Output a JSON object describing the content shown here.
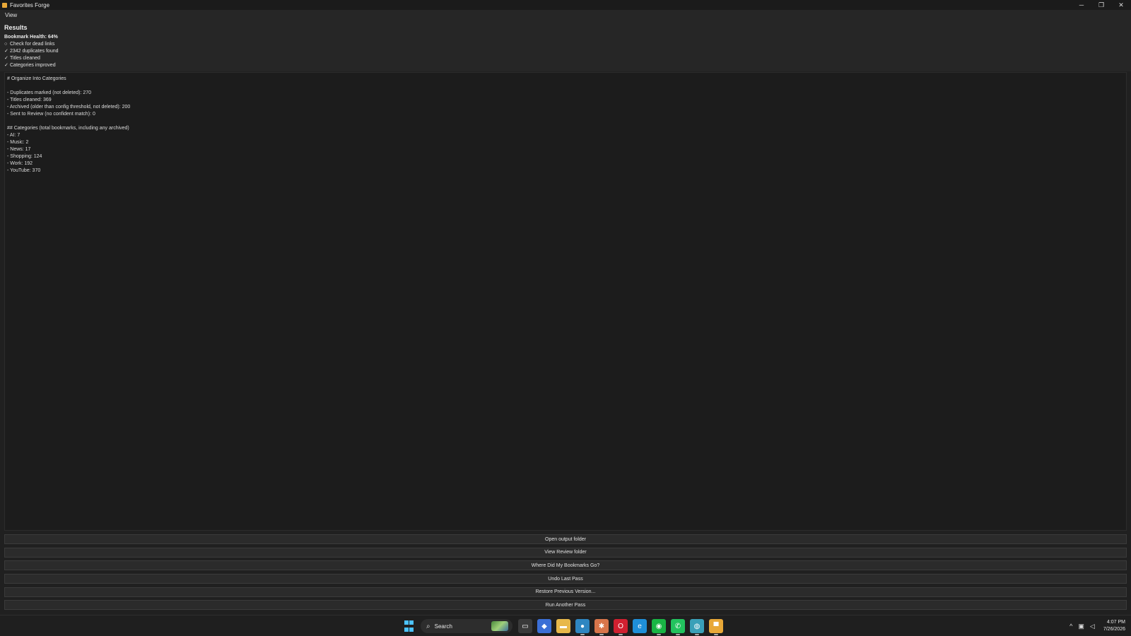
{
  "window": {
    "title": "Favorites Forge",
    "controls": {
      "minimize": "─",
      "restore": "❐",
      "close": "✕"
    }
  },
  "menu": {
    "items": [
      "View"
    ]
  },
  "summary": {
    "title": "Results",
    "health": "Bookmark Health: 64%",
    "checks": [
      {
        "mark": "○",
        "text": "Check for dead links"
      },
      {
        "mark": "✓",
        "text": "2342 duplicates found"
      },
      {
        "mark": "✓",
        "text": "Titles cleaned"
      },
      {
        "mark": "✓",
        "text": "Categories improved"
      }
    ]
  },
  "report": {
    "lines": [
      "# Organize Into Categories",
      "",
      "- Duplicates marked (not deleted): 270",
      "- Titles cleaned: 369",
      "- Archived (older than config threshold, not deleted): 200",
      "- Sent to Review (no confident match): 0",
      "",
      "## Categories (total bookmarks, including any archived)",
      "- AI: 7",
      "- Music: 2",
      "- News: 17",
      "- Shopping: 124",
      "- Work: 192",
      "- YouTube: 370"
    ]
  },
  "actions": [
    {
      "name": "open-output-folder-button",
      "label": "Open output folder"
    },
    {
      "name": "view-review-folder-button",
      "label": "View Review folder"
    },
    {
      "name": "where-did-my-bookmarks-go-button",
      "label": "Where Did My Bookmarks Go?"
    },
    {
      "name": "undo-last-pass-button",
      "label": "Undo Last Pass"
    },
    {
      "name": "restore-previous-version-button",
      "label": "Restore Previous Version..."
    },
    {
      "name": "run-another-pass-button",
      "label": "Run Another Pass"
    }
  ],
  "taskbar": {
    "search_placeholder": "Search",
    "apps": [
      {
        "name": "task-view-icon",
        "glyph": "▭",
        "color": "#3a3a3a"
      },
      {
        "name": "notes-app-icon",
        "glyph": "◆",
        "color": "#3b6fd6"
      },
      {
        "name": "file-explorer-icon",
        "glyph": "▬",
        "color": "#e8b84a"
      },
      {
        "name": "browser-app-icon",
        "glyph": "●",
        "color": "#2e86c1"
      },
      {
        "name": "claude-app-icon",
        "glyph": "✱",
        "color": "#d8754a"
      },
      {
        "name": "opera-icon",
        "glyph": "O",
        "color": "#d02030"
      },
      {
        "name": "edge-icon",
        "glyph": "e",
        "color": "#1f8fd8"
      },
      {
        "name": "line-app-icon",
        "glyph": "◉",
        "color": "#19b544"
      },
      {
        "name": "whatsapp-icon",
        "glyph": "✆",
        "color": "#22c35e"
      },
      {
        "name": "globe-app-icon",
        "glyph": "◍",
        "color": "#3aa0b8"
      },
      {
        "name": "favorites-forge-taskbar-icon",
        "glyph": "▀",
        "color": "#e8a838"
      }
    ],
    "tray": {
      "chevron": "^",
      "network": "▣",
      "volume": "◁"
    },
    "time": "4:07 PM",
    "date": "7/26/2026"
  }
}
